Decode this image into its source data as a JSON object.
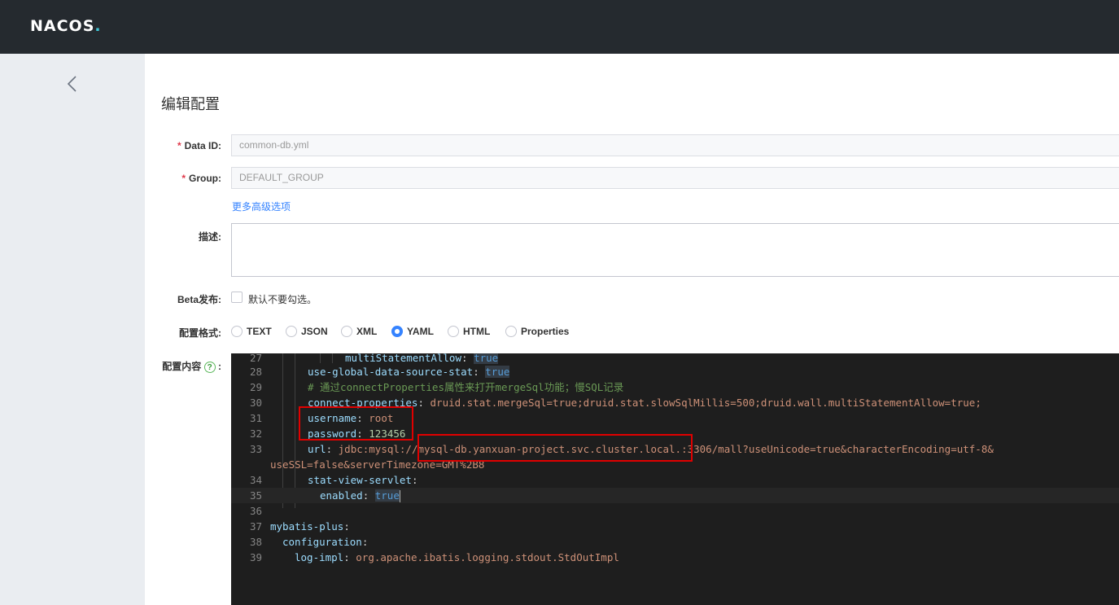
{
  "header": {
    "logo": "NACOS",
    "logo_dot": "."
  },
  "page": {
    "title": "编辑配置"
  },
  "form": {
    "data_id_label": "Data ID:",
    "data_id_value": "common-db.yml",
    "group_label": "Group:",
    "group_value": "DEFAULT_GROUP",
    "advanced_link": "更多高级选项",
    "desc_label": "描述:",
    "beta_label": "Beta发布:",
    "beta_hint": "默认不要勾选。",
    "format_label": "配置格式:",
    "formats": [
      "TEXT",
      "JSON",
      "XML",
      "YAML",
      "HTML",
      "Properties"
    ],
    "selected_format": "YAML",
    "content_label": "配置内容",
    "help_icon": "?",
    "colon": ":"
  },
  "editor": {
    "lines": [
      {
        "n": "27",
        "key": "multiStatementAllow",
        "val": "true",
        "type": "bool"
      },
      {
        "n": "28",
        "key": "use-global-data-source-stat",
        "val": "true",
        "type": "bool"
      },
      {
        "n": "29",
        "comment": "# 通过connectProperties属性来打开mergeSql功能；慢SQL记录"
      },
      {
        "n": "30",
        "key": "connect-properties",
        "val": "druid.stat.mergeSql=true;druid.stat.slowSqlMillis=500;druid.wall.multiStatementAllow=true;"
      },
      {
        "n": "31",
        "key": "username",
        "val": "root"
      },
      {
        "n": "32",
        "key": "password",
        "val": "123456"
      },
      {
        "n": "33",
        "key": "url",
        "val": "jdbc:mysql://mysql-db.yanxuan-project.svc.cluster.local.:3306/mall?useUnicode=true&characterEncoding=utf-8&"
      },
      {
        "n": "",
        "cont": "useSSL=false&serverTimezone=GMT%2B8"
      },
      {
        "n": "34",
        "key": "stat-view-servlet",
        "val": ""
      },
      {
        "n": "35",
        "key": "enabled",
        "val": "true",
        "type": "bool"
      },
      {
        "n": "36"
      },
      {
        "n": "37",
        "key": "mybatis-plus",
        "val": ""
      },
      {
        "n": "38",
        "key": "configuration",
        "val": ""
      },
      {
        "n": "39",
        "key": "log-impl",
        "val": "org.apache.ibatis.logging.stdout.StdOutImpl"
      }
    ]
  },
  "colors": {
    "topbar": "#252a2f",
    "sidebar": "#eaedf1",
    "accent": "#3583ff",
    "required": "#e0394a",
    "highlight_box": "#e00000"
  }
}
